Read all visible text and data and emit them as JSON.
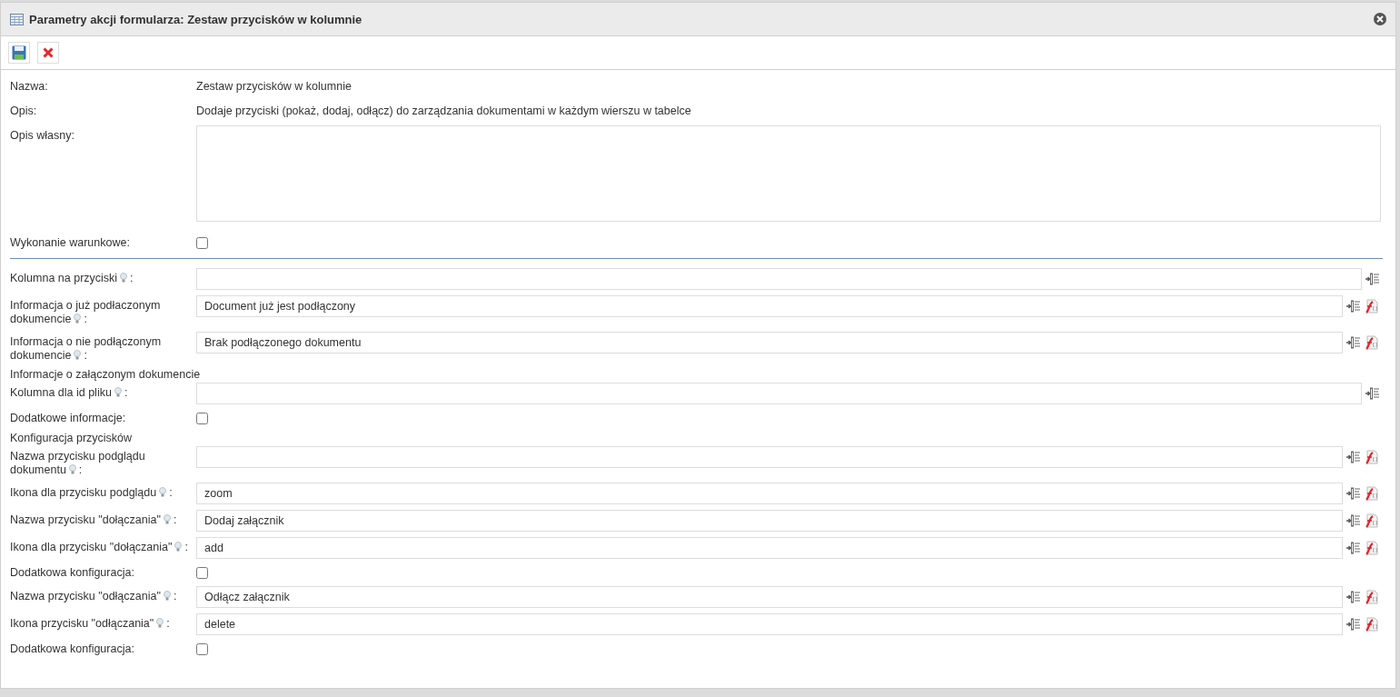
{
  "window": {
    "title": "Parametry akcji formularza: Zestaw przycisków w kolumnie"
  },
  "general": [
    {
      "kind": "text",
      "label": "Nazwa:",
      "value": "Zestaw przycisków w kolumnie"
    },
    {
      "kind": "text",
      "label": "Opis:",
      "value": "Dodaje przyciski (pokaż, dodaj, odłącz) do zarządzania dokumentami w każdym wierszu w tabelce"
    },
    {
      "kind": "textarea",
      "label": "Opis własny:"
    },
    {
      "kind": "checkbox",
      "label": "Wykonanie warunkowe:",
      "checked": false
    }
  ],
  "parameters": [
    {
      "kind": "input",
      "label": "Kolumna na przyciski",
      "hint": true,
      "after": ":",
      "function": false
    },
    {
      "kind": "input",
      "label": "Informacja o już podłaczonym dokumencie",
      "hint": true,
      "after": ":",
      "value": "Document już jest podłączony",
      "function": true
    },
    {
      "kind": "input",
      "label": "Informacja o nie podłączonym dokumencie",
      "hint": true,
      "after": ":",
      "value": "Brak podłączonego dokumentu",
      "function": true
    },
    {
      "kind": "section",
      "label": "Informacje o załączonym dokumencie"
    },
    {
      "kind": "input",
      "label": "Kolumna dla id pliku",
      "hint": true,
      "after": ":",
      "function": false
    },
    {
      "kind": "checkbox",
      "label": "Dodatkowe informacje:",
      "checked": false
    },
    {
      "kind": "section",
      "label": "Konfiguracja przycisków"
    },
    {
      "kind": "input",
      "label": "Nazwa przycisku podglądu dokumentu",
      "hint": true,
      "after": ":",
      "function": true
    },
    {
      "kind": "input",
      "label": "Ikona dla przycisku podglądu",
      "hint": true,
      "after": ":",
      "value": "zoom",
      "function": true
    },
    {
      "kind": "input",
      "label": "Nazwa przycisku \"dołączania\"",
      "hint": true,
      "after": ":",
      "value": "Dodaj załącznik",
      "function": true
    },
    {
      "kind": "input",
      "label": "Ikona dla przycisku \"dołączania\"",
      "hint": true,
      "after": ":",
      "value": "add",
      "function": true
    },
    {
      "kind": "checkbox",
      "label": "Dodatkowa konfiguracja:",
      "checked": false
    },
    {
      "kind": "input",
      "label": "Nazwa przycisku \"odłączania\"",
      "hint": true,
      "after": ":",
      "value": "Odłącz załącznik",
      "function": true
    },
    {
      "kind": "input",
      "label": "Ikona przycisku \"odłączania\"",
      "hint": true,
      "after": ":",
      "value": "delete",
      "function": true
    },
    {
      "kind": "checkbox",
      "label": "Dodatkowa konfiguracja:",
      "checked": false
    }
  ]
}
